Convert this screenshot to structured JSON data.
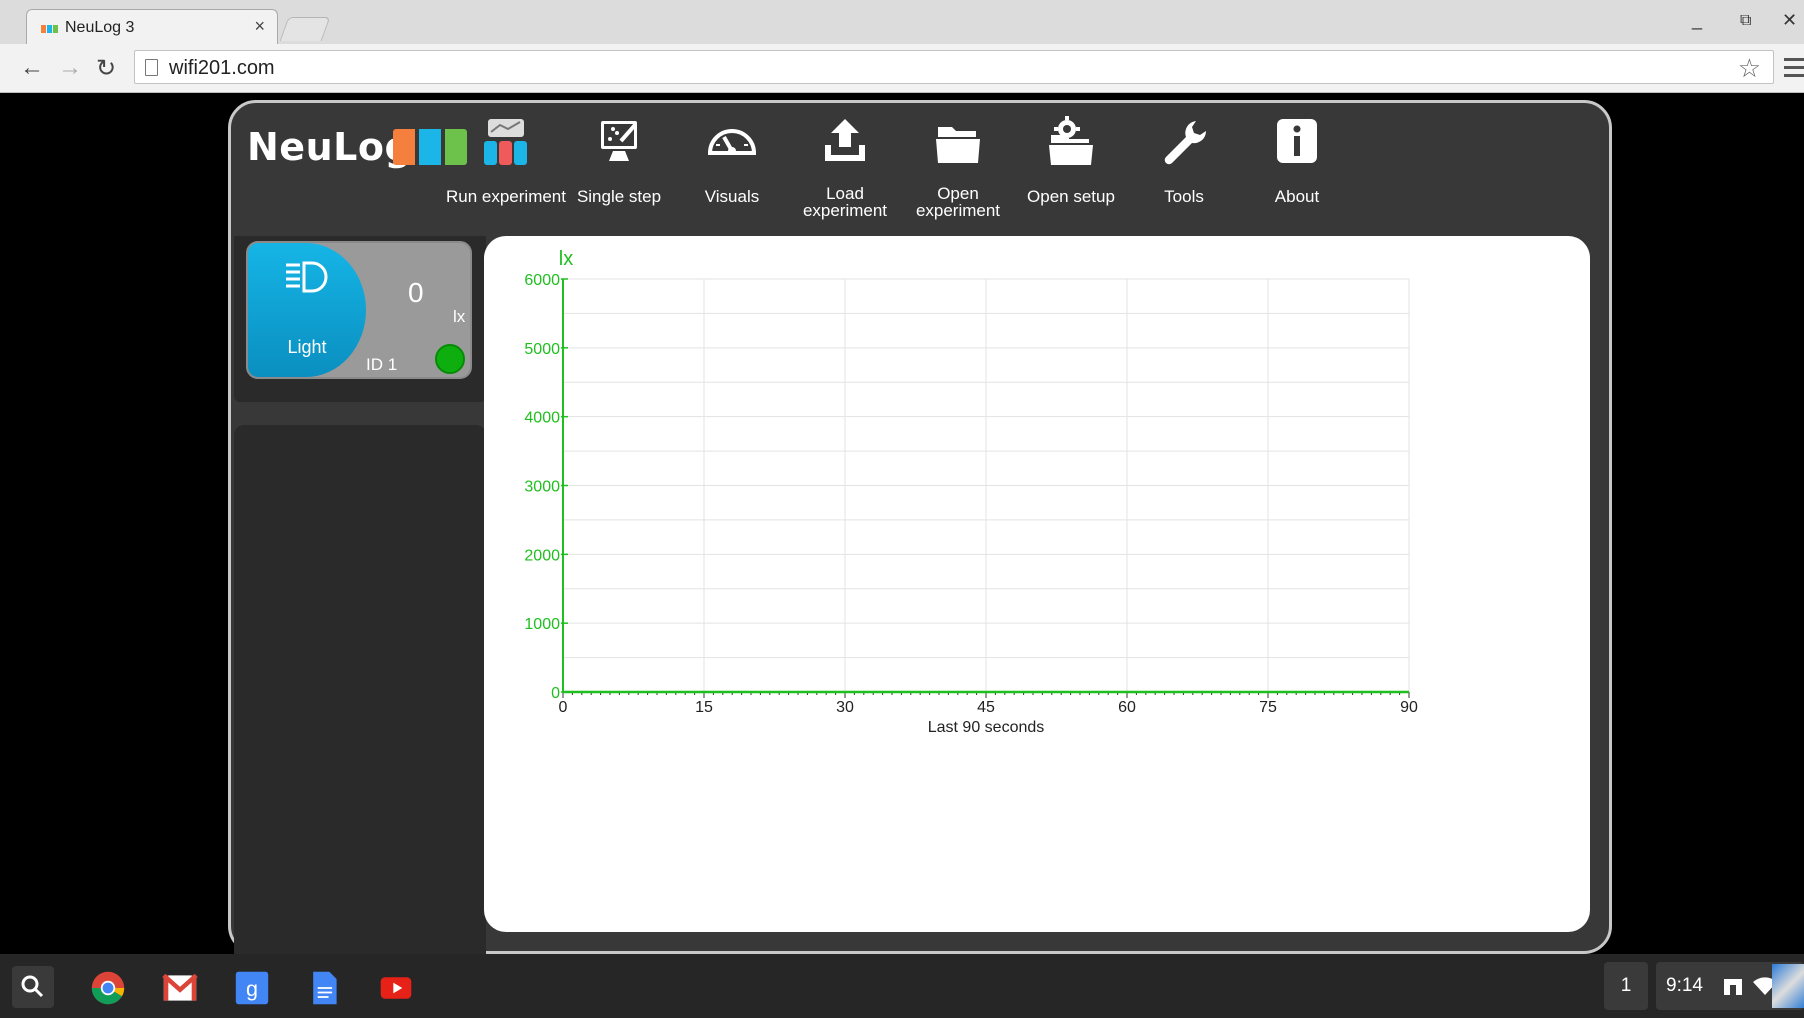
{
  "browser": {
    "tab_title": "NeuLog 3",
    "tab_close": "×",
    "url": "wifi201.com"
  },
  "app": {
    "logo_text": "NeuLog",
    "menu": [
      {
        "label_lines": [
          "Run experiment"
        ],
        "icon": "run-experiment-icon"
      },
      {
        "label_lines": [
          "Single step"
        ],
        "icon": "single-step-icon"
      },
      {
        "label_lines": [
          "Visuals"
        ],
        "icon": "gauge-icon"
      },
      {
        "label_lines": [
          "Load",
          "experiment"
        ],
        "icon": "upload-icon"
      },
      {
        "label_lines": [
          "Open",
          "experiment"
        ],
        "icon": "folder-icon"
      },
      {
        "label_lines": [
          "Open setup"
        ],
        "icon": "folder-gear-icon"
      },
      {
        "label_lines": [
          "Tools"
        ],
        "icon": "wrench-icon"
      },
      {
        "label_lines": [
          "About"
        ],
        "icon": "info-icon"
      }
    ],
    "sensor": {
      "name": "Light",
      "value": "0",
      "unit": "lx",
      "id_label": "ID 1",
      "icon": "headlight-icon",
      "status_color": "#0fae0f"
    }
  },
  "chart_data": {
    "type": "line",
    "ylabel": "lx",
    "xlabel": "Last 90 seconds",
    "xlim": [
      0,
      90
    ],
    "ylim": [
      0,
      6000
    ],
    "x_ticks": [
      0,
      15,
      30,
      45,
      60,
      75,
      90
    ],
    "y_ticks": [
      0,
      1000,
      2000,
      3000,
      4000,
      5000,
      6000
    ],
    "grid": true,
    "series": [
      {
        "x": [
          0,
          90
        ],
        "values": [
          0,
          0
        ],
        "color": "#1fbf1f"
      }
    ],
    "axis_color": "#1fbf1f"
  },
  "shelf": {
    "apps": [
      "chrome-icon",
      "gmail-icon",
      "google-search-icon",
      "docs-icon",
      "youtube-icon"
    ],
    "notification_count": "1",
    "time": "9:14"
  }
}
